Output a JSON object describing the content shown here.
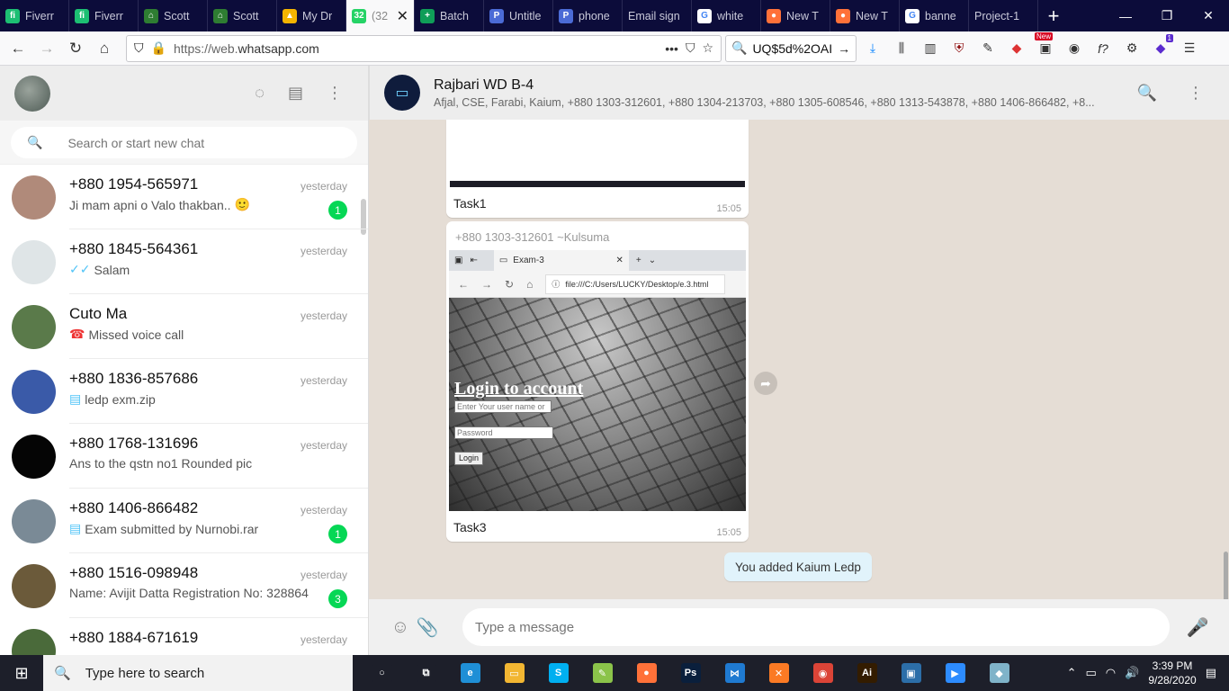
{
  "browser": {
    "tabs": [
      {
        "label": "Fiverr",
        "icon": "fiverr-icon",
        "color": "#1dbf73",
        "glyph": "fi"
      },
      {
        "label": "Fiverr",
        "icon": "fiverr-icon",
        "color": "#1dbf73",
        "glyph": "fi"
      },
      {
        "label": "Scott",
        "icon": "house-icon",
        "color": "#2e7d32",
        "glyph": "⌂"
      },
      {
        "label": "Scott",
        "icon": "house-icon",
        "color": "#2e7d32",
        "glyph": "⌂"
      },
      {
        "label": "My Dr",
        "icon": "google-drive-icon",
        "color": "#f4b400",
        "glyph": "▲"
      },
      {
        "label": "(32",
        "icon": "whatsapp-icon",
        "color": "#25d366",
        "glyph": "32",
        "active": true
      },
      {
        "label": "Batch",
        "icon": "sheets-icon",
        "color": "#0f9d58",
        "glyph": "+"
      },
      {
        "label": "Untitle",
        "icon": "doc-icon",
        "color": "#4b6bd6",
        "glyph": "P"
      },
      {
        "label": "phone",
        "icon": "doc-icon",
        "color": "#4b6bd6",
        "glyph": "P"
      },
      {
        "label": "Email sign",
        "icon": "",
        "color": "#0c0c3a",
        "glyph": ""
      },
      {
        "label": "white",
        "icon": "google-icon",
        "color": "#ffffff",
        "glyph": "G"
      },
      {
        "label": "New T",
        "icon": "firefox-icon",
        "color": "#ff7139",
        "glyph": "●"
      },
      {
        "label": "New T",
        "icon": "firefox-icon",
        "color": "#ff7139",
        "glyph": "●"
      },
      {
        "label": "banne",
        "icon": "google-icon",
        "color": "#ffffff",
        "glyph": "G"
      },
      {
        "label": "Project-1",
        "icon": "",
        "color": "#0c0c3a",
        "glyph": ""
      }
    ],
    "url_prefix": "https://web.",
    "url_domain": "whatsapp.com",
    "search_value": "UQ$5d%2OAI",
    "downloads_badge": "New",
    "extensions_badge": "1"
  },
  "whatsapp": {
    "search_placeholder": "Search or start new chat",
    "chats": [
      {
        "name": "+880 1954-565971",
        "time": "yesterday",
        "preview": "Ji mam apni o Valo thakban..",
        "prefix": "",
        "emoji": "🙂",
        "badge": "1",
        "avatar": "#b08a7a"
      },
      {
        "name": "+880 1845-564361",
        "time": "yesterday",
        "preview": "Salam",
        "prefix": "✓✓",
        "emoji": "",
        "badge": "",
        "avatar": "#dfe5e7"
      },
      {
        "name": "Cuto Ma",
        "time": "yesterday",
        "preview": "Missed voice call",
        "prefix": "☎",
        "emoji": "",
        "badge": "",
        "avatar": "#5a7a4a"
      },
      {
        "name": "+880 1836-857686",
        "time": "yesterday",
        "preview": "ledp exm.zip",
        "prefix": "▤",
        "emoji": "",
        "badge": "",
        "avatar": "#3a5aa8"
      },
      {
        "name": "+880 1768-131696",
        "time": "yesterday",
        "preview": "Ans to the qstn no1 Rounded pic",
        "prefix": "",
        "emoji": "",
        "badge": "",
        "avatar": "#050505"
      },
      {
        "name": "+880 1406-866482",
        "time": "yesterday",
        "preview": "Exam submitted by Nurnobi.rar",
        "prefix": "▤",
        "emoji": "",
        "badge": "1",
        "avatar": "#7a8a96"
      },
      {
        "name": "+880 1516-098948",
        "time": "yesterday",
        "preview": "Name: Avijit Datta Registration No: 328864",
        "prefix": "",
        "emoji": "",
        "badge": "3",
        "avatar": "#6b5a3a"
      },
      {
        "name": "+880 1884-671619",
        "time": "yesterday",
        "preview": "",
        "prefix": "",
        "emoji": "",
        "badge": "",
        "avatar": "#4a6a3a"
      }
    ],
    "group": {
      "name": "Rajbari WD B-4",
      "members": "Afjal, CSE, Farabi, Kaium, +880 1303-312601, +880 1304-213703, +880 1305-608546, +880 1313-543878, +880 1406-866482, +8..."
    },
    "messages": [
      {
        "caption": "Task1",
        "time": "15:05"
      },
      {
        "sender": "+880 1303-312601  ~Kulsuma",
        "caption": "Task3",
        "time": "15:05",
        "screenshot": {
          "tab_title": "Exam-3",
          "url": "file:///C:/Users/LUCKY/Desktop/e.3.html",
          "login_title": "Login to account",
          "user_placeholder": "Enter Your user name or",
          "password_placeholder": "Password",
          "login_button": "Login"
        }
      }
    ],
    "system_message": "You added Kaium Ledp",
    "composer_placeholder": "Type a message"
  },
  "taskbar": {
    "search_placeholder": "Type here to search",
    "apps": [
      {
        "icon": "cortana-icon",
        "color": "#1d1f2a",
        "glyph": "○"
      },
      {
        "icon": "task-view-icon",
        "color": "#1d1f2a",
        "glyph": "⧉"
      },
      {
        "icon": "edge-icon",
        "color": "#1f8fd6",
        "glyph": "e"
      },
      {
        "icon": "file-explorer-icon",
        "color": "#f2b632",
        "glyph": "▭"
      },
      {
        "icon": "skype-icon",
        "color": "#00aff0",
        "glyph": "S"
      },
      {
        "icon": "notepadpp-icon",
        "color": "#8bc34a",
        "glyph": "✎"
      },
      {
        "icon": "firefox-icon",
        "color": "#ff7139",
        "glyph": "●"
      },
      {
        "icon": "photoshop-icon",
        "color": "#0a1f3c",
        "glyph": "Ps"
      },
      {
        "icon": "vscode-icon",
        "color": "#1f7ad1",
        "glyph": "⋈"
      },
      {
        "icon": "xampp-icon",
        "color": "#fb7a24",
        "glyph": "✕"
      },
      {
        "icon": "chrome-icon",
        "color": "#db4437",
        "glyph": "◉"
      },
      {
        "icon": "illustrator-icon",
        "color": "#331c00",
        "glyph": "Ai"
      },
      {
        "icon": "app-icon",
        "color": "#2c6ea8",
        "glyph": "▣"
      },
      {
        "icon": "zoom-icon",
        "color": "#2d8cff",
        "glyph": "▶"
      },
      {
        "icon": "app-icon",
        "color": "#7fb3c9",
        "glyph": "◆"
      }
    ],
    "time": "3:39 PM",
    "date": "9/28/2020"
  }
}
